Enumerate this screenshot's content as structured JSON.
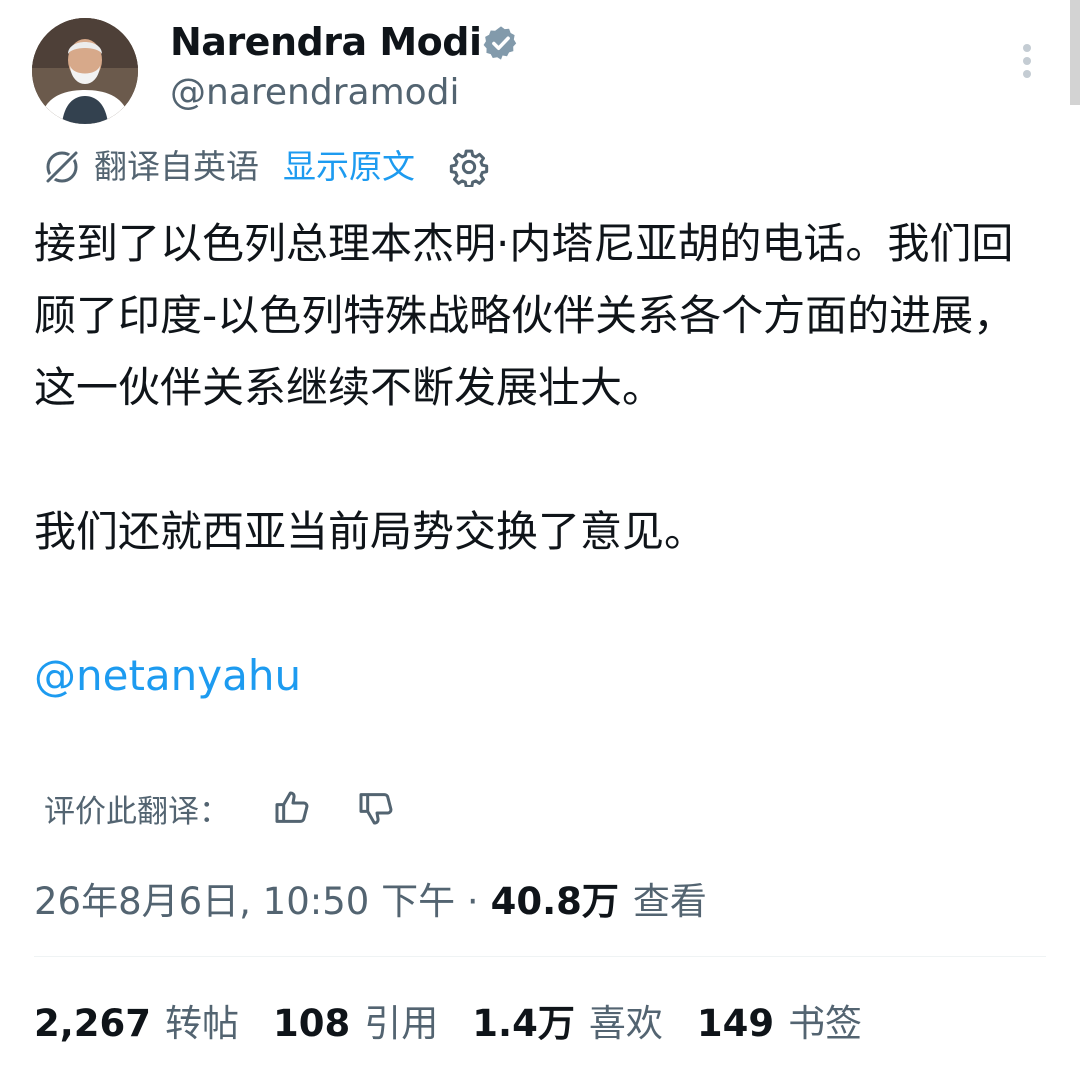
{
  "author": {
    "name": "Narendra Modi",
    "handle": "@narendramodi",
    "verified": true
  },
  "translation": {
    "label": "翻译自英语",
    "show_original": "显示原文"
  },
  "tweet": {
    "paragraphs": [
      "接到了以色列总理本杰明·内塔尼亚胡的电话。我们回顾了印度-以色列特殊战略伙伴关系各个方面的进展，这一伙伴关系继续不断发展壮大。",
      "我们还就西亚当前局势交换了意见。"
    ],
    "mention": "@netanyahu"
  },
  "rating": {
    "label": "评价此翻译："
  },
  "meta": {
    "timestamp": "26年8月6日, 10:50 下午 ·",
    "views_count": "40.8万",
    "views_label": "查看"
  },
  "stats": [
    {
      "count": "2,267",
      "label": "转帖"
    },
    {
      "count": "108",
      "label": "引用"
    },
    {
      "count": "1.4万",
      "label": "喜欢"
    },
    {
      "count": "149",
      "label": "书签"
    }
  ],
  "colors": {
    "accent": "#1d9bf0",
    "text_primary": "#0f1419",
    "text_secondary": "#536471",
    "verified_badge": "#829aab"
  },
  "icons": [
    "verified-badge-icon",
    "more-vertical-icon",
    "translate-icon",
    "gear-icon",
    "thumbs-up-icon",
    "thumbs-down-icon"
  ]
}
